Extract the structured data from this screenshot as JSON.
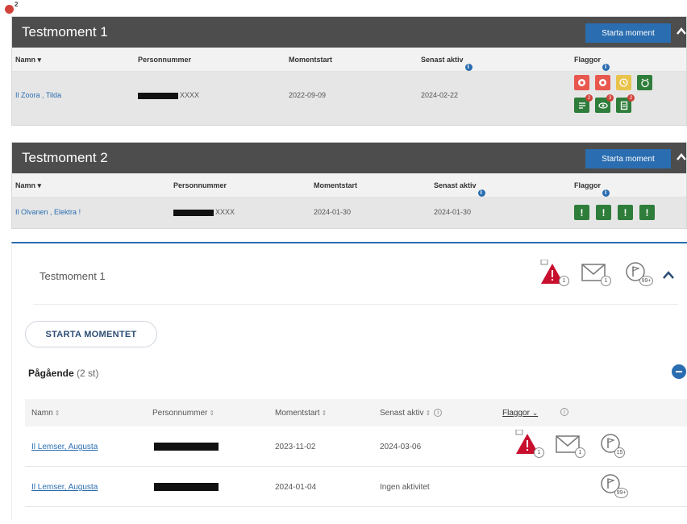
{
  "corner_badge": {
    "count": "2"
  },
  "panel1": {
    "title": "Testmoment 1",
    "start_label": "Starta moment",
    "columns": {
      "name": "Namn",
      "pnr": "Personnummer",
      "start": "Momentstart",
      "last": "Senast aktiv",
      "flags": "Flaggor"
    },
    "row": {
      "name": "Il Zoora , Tilda",
      "pnr_suffix": "XXXX",
      "start": "2022-09-09",
      "last": "2024-02-22"
    },
    "flag_badges": [
      "2",
      "3",
      "2"
    ]
  },
  "panel2": {
    "title": "Testmoment 2",
    "start_label": "Starta moment",
    "columns": {
      "name": "Namn",
      "pnr": "Personnummer",
      "start": "Momentstart",
      "last": "Senast aktiv",
      "flags": "Flaggor"
    },
    "row": {
      "name": "Il Olvanen , Elektra",
      "alert": "!",
      "pnr_suffix": "XXXX",
      "start": "2024-01-30",
      "last": "2024-01-30"
    },
    "flag_glyph": "!"
  },
  "panel3": {
    "title": "Testmoment 1",
    "header_badges": {
      "alert": "1",
      "mail": "1",
      "flag": "99+"
    },
    "start_label": "STARTA MOMENTET",
    "ongoing_label": "Pågående",
    "ongoing_count": "(2 st)",
    "columns": {
      "name": "Namn",
      "pnr": "Personnummer",
      "start": "Momentstart",
      "last": "Senast aktiv",
      "flags": "Flaggor"
    },
    "rows": [
      {
        "name": "Il Lemser, Augusta",
        "start": "2023-11-02",
        "last": "2024-03-06",
        "badges": {
          "alert": "1",
          "mail": "1",
          "flag": "15"
        }
      },
      {
        "name": "Il Lemser, Augusta",
        "start": "2024-01-04",
        "last": "Ingen aktivitet",
        "badges": {
          "flag": "99+"
        }
      }
    ]
  },
  "colors": {
    "header_dark": "#4d4d4d",
    "accent_blue": "#2a6db0",
    "alert_red": "#c8102e",
    "flag_red": "#e8584f",
    "flag_yellow": "#e9c34a",
    "flag_green": "#2f7d3a"
  }
}
